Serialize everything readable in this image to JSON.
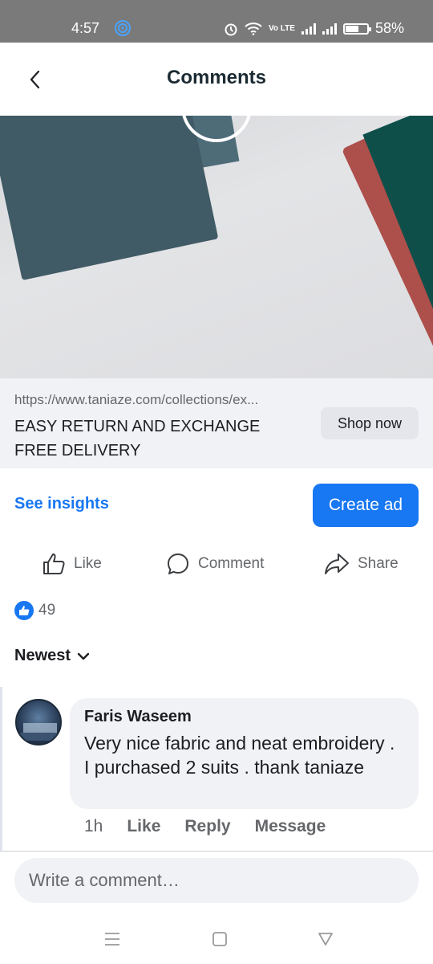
{
  "status_bar": {
    "time": "4:57",
    "network_label": "Vo LTE",
    "battery": "58%",
    "battery_level": 0.58
  },
  "header": {
    "title": "Comments",
    "back_icon": "chevron-left-icon"
  },
  "video": {
    "play_icon": "play-icon",
    "mute_icon": "speaker-muted-icon"
  },
  "link_preview": {
    "url": "https://www.taniaze.com/collections/ex...",
    "headline_line1": "EASY RETURN AND EXCHANGE",
    "headline_line2": "FREE DELIVERY",
    "cta_label": "Shop now"
  },
  "insights": {
    "see_insights_label": "See insights",
    "create_ad_label": "Create ad"
  },
  "actions": {
    "like_label": "Like",
    "comment_label": "Comment",
    "share_label": "Share"
  },
  "reactions": {
    "count": "49"
  },
  "sort": {
    "label": "Newest"
  },
  "comments": [
    {
      "author": "Faris Waseem",
      "text": "Very nice fabric and neat embroidery . I purchased 2 suits . thank taniaze",
      "time": "1h",
      "like_label": "Like",
      "reply_label": "Reply",
      "message_label": "Message"
    }
  ],
  "compose": {
    "placeholder": "Write a comment…"
  },
  "colors": {
    "accent": "#1877f2",
    "status_bar": "#7a7a7a",
    "secondary_text": "#65676b",
    "surface": "#f0f2f5"
  }
}
